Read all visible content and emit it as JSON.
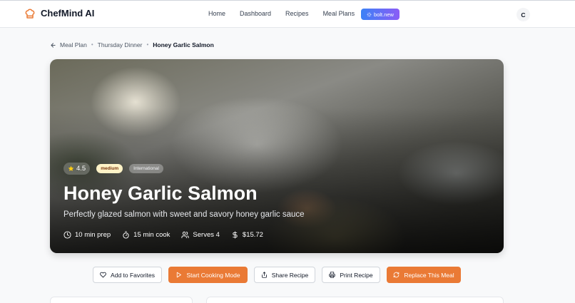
{
  "nav": {
    "brand": "ChefMind AI",
    "links": [
      "Home",
      "Dashboard",
      "Recipes",
      "Meal Plans"
    ],
    "bolt_label": "bolt.new",
    "avatar_initial": "C"
  },
  "breadcrumb": {
    "items": [
      "Meal Plan",
      "Thursday Dinner"
    ],
    "current": "Honey Garlic Salmon"
  },
  "recipe": {
    "rating": "4.5",
    "difficulty": "medium",
    "cuisine": "International",
    "title": "Honey Garlic Salmon",
    "subtitle": "Perfectly glazed salmon with sweet and savory honey garlic sauce",
    "prep": "10 min prep",
    "cook": "15 min cook",
    "serves": "Serves 4",
    "cost": "$15.72"
  },
  "actions": {
    "favorites": "Add to Favorites",
    "cooking_mode": "Start Cooking Mode",
    "share": "Share Recipe",
    "print": "Print Recipe",
    "replace": "Replace This Meal"
  },
  "colors": {
    "accent": "#ea7a35",
    "bolt_start": "#3b82f6",
    "bolt_end": "#8b5cf6"
  }
}
